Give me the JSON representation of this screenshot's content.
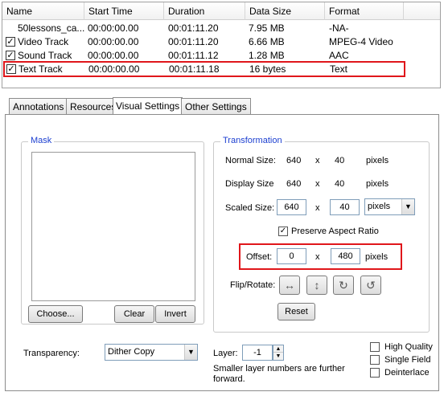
{
  "table": {
    "headers": [
      "Name",
      "Start Time",
      "Duration",
      "Data Size",
      "Format"
    ],
    "rows": [
      {
        "checked": false,
        "name": "50lessons_ca...",
        "start": "00:00:00.00",
        "duration": "00:01:11.20",
        "size": "7.95 MB",
        "format": "-NA-"
      },
      {
        "checked": true,
        "name": "Video Track",
        "start": "00:00:00.00",
        "duration": "00:01:11.20",
        "size": "6.66 MB",
        "format": "MPEG-4 Video"
      },
      {
        "checked": true,
        "name": "Sound Track",
        "start": "00:00:00.00",
        "duration": "00:01:11.12",
        "size": "1.28 MB",
        "format": "AAC"
      },
      {
        "checked": true,
        "name": "Text Track",
        "start": "00:00:00.00",
        "duration": "00:01:11.18",
        "size": "16 bytes",
        "format": "Text"
      }
    ]
  },
  "tabs": [
    "Annotations",
    "Resources",
    "Visual Settings",
    "Other Settings"
  ],
  "active_tab": "Visual Settings",
  "mask": {
    "title": "Mask",
    "choose": "Choose...",
    "clear": "Clear",
    "invert": "Invert"
  },
  "transformation": {
    "title": "Transformation",
    "normal_label": "Normal Size:",
    "normal_w": "640",
    "normal_x": "x",
    "normal_h": "40",
    "normal_unit": "pixels",
    "display_label": "Display Size",
    "display_w": "640",
    "display_x": "x",
    "display_h": "40",
    "display_unit": "pixels",
    "scaled_label": "Scaled Size:",
    "scaled_w": "640",
    "scaled_x": "x",
    "scaled_h": "40",
    "scaled_unit": "pixels",
    "preserve_label": "Preserve Aspect Ratio",
    "preserve_checked": true,
    "offset_label": "Offset:",
    "offset_x_val": "0",
    "offset_x": "x",
    "offset_y_val": "480",
    "offset_unit": "pixels",
    "flip_label": "Flip/Rotate:",
    "reset": "Reset"
  },
  "transparency": {
    "label": "Transparency:",
    "value": "Dither Copy"
  },
  "layer": {
    "label": "Layer:",
    "value": "-1",
    "note": "Smaller layer numbers are further forward."
  },
  "options": [
    {
      "label": "High Quality",
      "checked": false
    },
    {
      "label": "Single Field",
      "checked": false
    },
    {
      "label": "Deinterlace",
      "checked": false
    }
  ],
  "accent": {
    "highlight": "#e0161b",
    "legend": "#1c3fd0"
  }
}
